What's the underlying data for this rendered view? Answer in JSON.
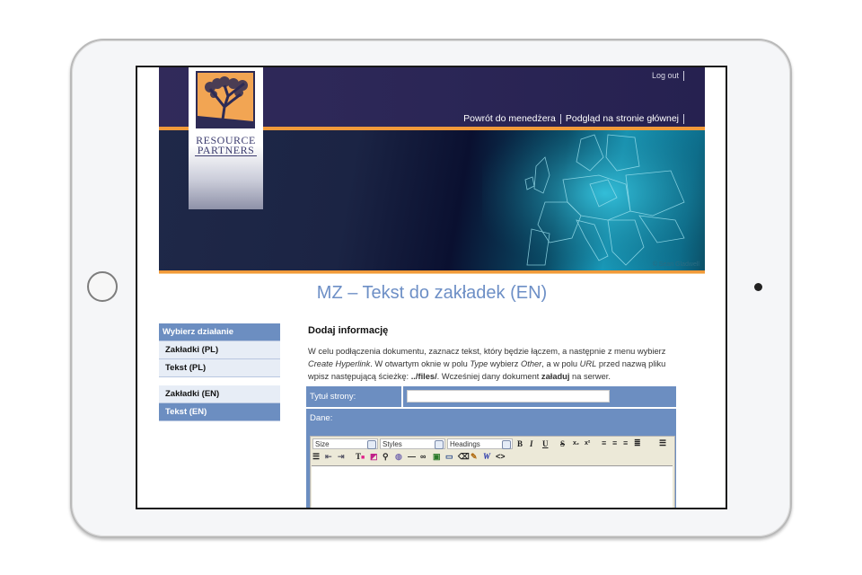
{
  "brand": {
    "line1": "RESOURCE",
    "line2": "PARTNERS"
  },
  "header": {
    "logout": "Log out",
    "links": [
      "Powrót do menedżera",
      "Podgląd na stronie głównej"
    ],
    "copyright": "© Sean Gladwell"
  },
  "page_title": "MZ – Tekst do zakładek (EN)",
  "sidebar": {
    "heading": "Wybierz działanie",
    "group1": [
      {
        "label": "Zakładki (PL)"
      },
      {
        "label": "Tekst (PL)"
      }
    ],
    "group2": [
      {
        "label": "Zakładki (EN)"
      },
      {
        "label": "Tekst (EN)",
        "active": true
      }
    ]
  },
  "main": {
    "heading": "Dodaj informację",
    "info": {
      "p1": "W celu podłączenia dokumentu, zaznacz tekst, który będzie łączem, a następnie z menu wybierz ",
      "em1": "Create Hyperlink",
      "p2": ". W otwartym oknie w polu ",
      "em2": "Type",
      "p3": " wybierz ",
      "em3": "Other",
      "p4": ", a w polu ",
      "em4": "URL",
      "p5": " przed nazwą pliku wpisz następującą ścieżkę: ",
      "b1": "../files/",
      "p6": ". Wcześniej dany dokument ",
      "b2": "załaduj",
      "p7": " na serwer."
    },
    "form": {
      "title_label": "Tytuł strony:",
      "title_value": "",
      "data_label": "Dane:"
    },
    "editor": {
      "size_select": "Size",
      "styles_select": "Styles",
      "headings_select": "Headings",
      "format_buttons": [
        "bold",
        "italic",
        "underline",
        "strikethrough",
        "subscript",
        "superscript",
        "align-left",
        "align-center",
        "align-right",
        "justify",
        "ordered-list"
      ],
      "row2_buttons": [
        "unordered-list",
        "outdent",
        "indent",
        "text-color",
        "background-color",
        "find",
        "spellcheck",
        "horizontal-rule",
        "link",
        "image",
        "table",
        "eraser",
        "clean",
        "word-paste",
        "source-code"
      ],
      "content": ""
    }
  },
  "colors": {
    "accent": "#6c8ec1",
    "header_navy": "#2b2656",
    "orange": "#f19a3a",
    "title_blue": "#6d8fc6"
  }
}
